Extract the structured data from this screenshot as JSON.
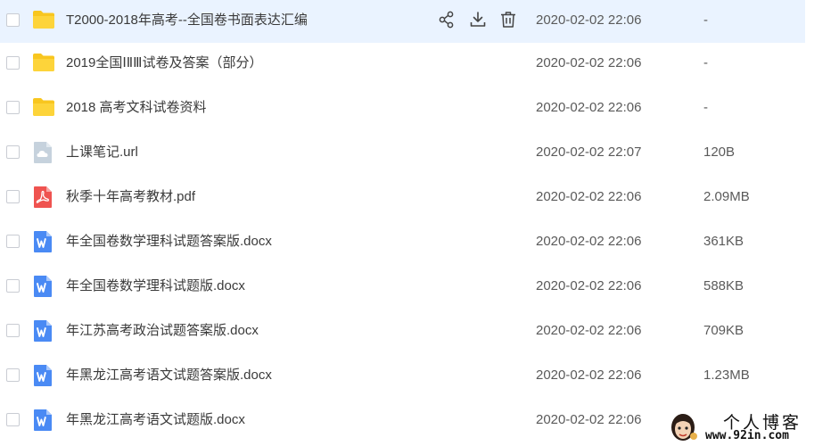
{
  "files": [
    {
      "name": "T2000-2018年高考--全国卷书面表达汇编",
      "type": "folder",
      "date": "2020-02-02 22:06",
      "size": "-",
      "hover": true
    },
    {
      "name": "2019全国ⅠⅡⅢ试卷及答案（部分）",
      "type": "folder",
      "date": "2020-02-02 22:06",
      "size": "-"
    },
    {
      "name": "2018 高考文科试卷资料",
      "type": "folder",
      "date": "2020-02-02 22:06",
      "size": "-"
    },
    {
      "name": "上课笔记.url",
      "type": "url",
      "date": "2020-02-02 22:07",
      "size": "120B"
    },
    {
      "name": "秋季十年高考教材.pdf",
      "type": "pdf",
      "date": "2020-02-02 22:06",
      "size": "2.09MB"
    },
    {
      "name": "年全国卷数学理科试题答案版.docx",
      "type": "docx",
      "date": "2020-02-02 22:06",
      "size": "361KB"
    },
    {
      "name": "年全国卷数学理科试题版.docx",
      "type": "docx",
      "date": "2020-02-02 22:06",
      "size": "588KB"
    },
    {
      "name": "年江苏高考政治试题答案版.docx",
      "type": "docx",
      "date": "2020-02-02 22:06",
      "size": "709KB"
    },
    {
      "name": "年黑龙江高考语文试题答案版.docx",
      "type": "docx",
      "date": "2020-02-02 22:06",
      "size": "1.23MB"
    },
    {
      "name": "年黑龙江高考语文试题版.docx",
      "type": "docx",
      "date": "2020-02-02 22:06",
      "size": ""
    }
  ],
  "row_actions": [
    {
      "icon": "share-icon"
    },
    {
      "icon": "download-icon"
    },
    {
      "icon": "delete-icon"
    }
  ],
  "watermark": {
    "title": "个人博客",
    "url": "www.92in.com"
  },
  "colors": {
    "hover_row": "#eaf3ff",
    "folder": "#f8c61f",
    "pdf": "#ef5350",
    "docx": "#4a8af4",
    "url": "#c6d2dd"
  }
}
